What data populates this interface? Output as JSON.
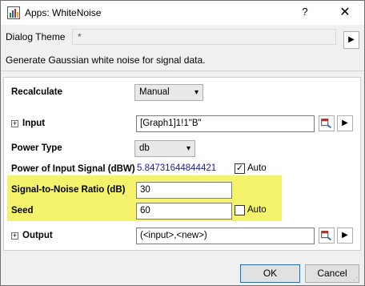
{
  "window": {
    "title": "Apps: WhiteNoise",
    "help": "?",
    "close": "✕"
  },
  "theme": {
    "label": "Dialog Theme",
    "value": "*",
    "arrow": "▶"
  },
  "description": "Generate Gaussian white noise for signal data.",
  "recalculate": {
    "label": "Recalculate",
    "value": "Manual"
  },
  "input": {
    "label": "Input",
    "value": "[Graph1]1!1\"B\""
  },
  "power_type": {
    "label": "Power Type",
    "value": "db"
  },
  "power_signal": {
    "label": "Power of Input Signal (dBW)",
    "value": "5.84731644844421",
    "auto_label": "Auto",
    "auto_checked": true
  },
  "snr": {
    "label": "Signal-to-Noise Ratio (dB)",
    "value": "30"
  },
  "seed": {
    "label": "Seed",
    "value": "60",
    "auto_label": "Auto",
    "auto_checked": false
  },
  "output": {
    "label": "Output",
    "value": "(<input>,<new>)"
  },
  "buttons": {
    "ok": "OK",
    "cancel": "Cancel"
  },
  "colors": {
    "highlight": "#f4f36b",
    "link": "#1a1aa6",
    "accent": "#0078d7"
  },
  "icons": [
    "app-icon",
    "help-icon",
    "close-icon",
    "expand-icon",
    "select-range-icon",
    "menu-arrow-icon",
    "chevron-down-icon",
    "checkbox-check-icon"
  ]
}
